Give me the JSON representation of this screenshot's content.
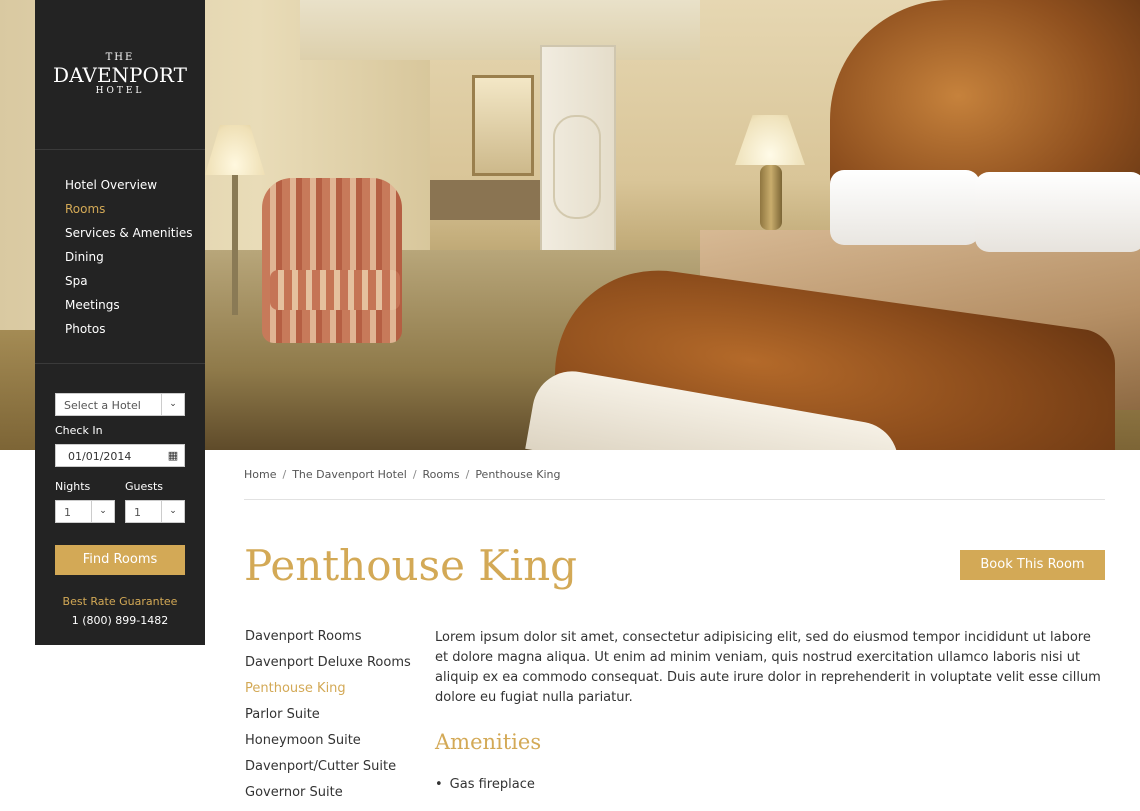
{
  "brand": {
    "the": "THE",
    "name": "DAVENPORT",
    "hotel": "HOTEL"
  },
  "nav": {
    "items": [
      {
        "label": "Hotel Overview",
        "active": false
      },
      {
        "label": "Rooms",
        "active": true
      },
      {
        "label": "Services & Amenities",
        "active": false
      },
      {
        "label": "Dining",
        "active": false
      },
      {
        "label": "Spa",
        "active": false
      },
      {
        "label": "Meetings",
        "active": false
      },
      {
        "label": "Photos",
        "active": false
      }
    ]
  },
  "booking": {
    "hotel_select": "Select a Hotel",
    "checkin_label": "Check In",
    "checkin_value": "01/01/2014",
    "nights_label": "Nights",
    "nights_value": "1",
    "guests_label": "Guests",
    "guests_value": "1",
    "find_button": "Find Rooms",
    "rate_guarantee": "Best Rate Guarantee",
    "phone": "1 (800) 899-1482"
  },
  "breadcrumb": [
    "Home",
    "The Davenport Hotel",
    "Rooms",
    "Penthouse King"
  ],
  "page_title": "Penthouse King",
  "book_button": "Book This Room",
  "rooms": [
    {
      "label": "Davenport Rooms",
      "active": false
    },
    {
      "label": "Davenport Deluxe Rooms",
      "active": false
    },
    {
      "label": "Penthouse King",
      "active": true
    },
    {
      "label": "Parlor Suite",
      "active": false
    },
    {
      "label": "Honeymoon Suite",
      "active": false
    },
    {
      "label": "Davenport/Cutter Suite",
      "active": false
    },
    {
      "label": "Governor Suite",
      "active": false
    }
  ],
  "description": "Lorem ipsum dolor sit amet, consectetur adipisicing elit, sed do eiusmod tempor incididunt ut labore et dolore magna aliqua. Ut enim ad minim veniam, quis nostrud exercitation ullamco laboris nisi ut aliquip ex ea commodo consequat. Duis aute irure dolor in reprehenderit in voluptate velit esse cillum dolore eu fugiat nulla pariatur.",
  "amenities_title": "Amenities",
  "amenities": [
    "Gas fireplace"
  ],
  "colors": {
    "accent": "#d3a956",
    "sidebar": "#232323"
  }
}
